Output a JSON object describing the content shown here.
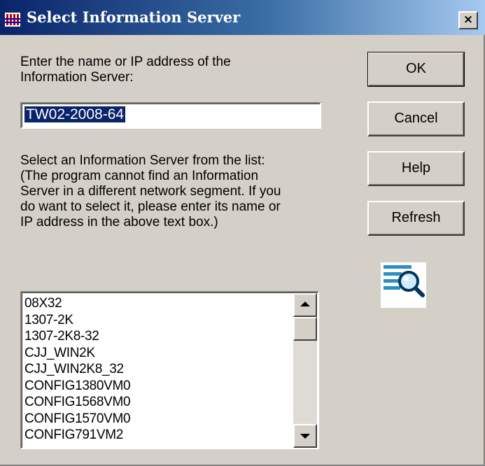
{
  "window": {
    "title": "Select Information Server",
    "close_label": "×"
  },
  "prompt": {
    "line1": "Enter the name or IP address of the",
    "line2": "Information Server:"
  },
  "server_input": {
    "value": "TW02-2008-64"
  },
  "list_prompt": {
    "lines": [
      "Select an Information Server from the list:",
      "(The program cannot find an Information",
      "Server in a different network segment. If you",
      "do want to select it, please enter its name or",
      "IP address in the above text box.)"
    ]
  },
  "buttons": {
    "ok": "OK",
    "cancel": "Cancel",
    "help": "Help",
    "refresh": "Refresh"
  },
  "server_list": {
    "items": [
      "08X32",
      "1307-2K",
      "1307-2K8-32",
      "CJJ_WIN2K",
      "CJJ_WIN2K8_32",
      "CONFIG1380VM0",
      "CONFIG1568VM0",
      "CONFIG1570VM0",
      "CONFIG791VM2"
    ]
  },
  "icons": {
    "title": "network-app-icon",
    "search": "search-list-icon"
  },
  "colors": {
    "titlebar_start": "#0a246a",
    "titlebar_end": "#a6caf0",
    "face": "#d4d0c8",
    "selection": "#0a246a"
  }
}
